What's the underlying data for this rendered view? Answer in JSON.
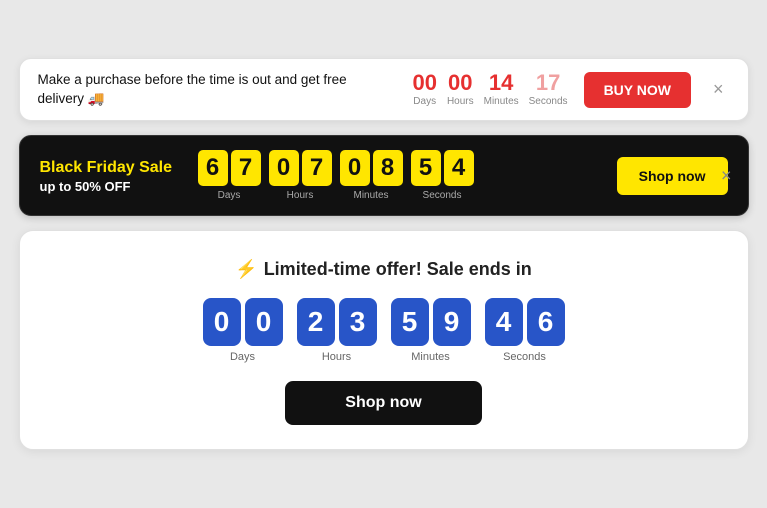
{
  "banner1": {
    "text": "Make a purchase before the time is out and get free delivery 🚚",
    "timer": {
      "days": "00",
      "hours": "00",
      "minutes": "14",
      "seconds": "17",
      "days_label": "Days",
      "hours_label": "Hours",
      "minutes_label": "Minutes",
      "seconds_label": "Seconds"
    },
    "buy_btn": "BUY NOW",
    "close_icon": "×"
  },
  "banner2": {
    "title": "Black Friday Sale",
    "subtitle": "up to 50% OFF",
    "timer": {
      "days": [
        "6",
        "7"
      ],
      "hours": [
        "0",
        "7"
      ],
      "minutes": [
        "0",
        "8"
      ],
      "seconds": [
        "5",
        "4"
      ],
      "days_label": "Days",
      "hours_label": "Hours",
      "minutes_label": "Minutes",
      "seconds_label": "Seconds"
    },
    "shop_btn": "Shop now",
    "close_icon": "×"
  },
  "banner3": {
    "title_icon": "⚡",
    "title": "Limited-time offer! Sale ends in",
    "timer": {
      "days": [
        "0",
        "0"
      ],
      "hours": [
        "2",
        "3"
      ],
      "minutes": [
        "5",
        "9"
      ],
      "seconds": [
        "4",
        "6"
      ],
      "days_label": "Days",
      "hours_label": "Hours",
      "minutes_label": "Minutes",
      "seconds_label": "Seconds"
    },
    "shop_btn": "Shop now"
  }
}
